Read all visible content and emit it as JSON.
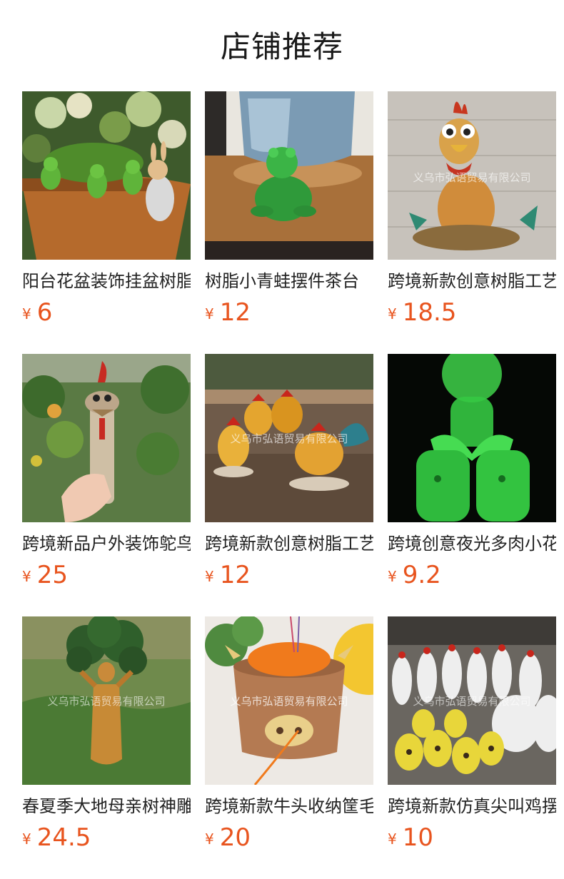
{
  "page": {
    "title": "店铺推荐"
  },
  "watermark": "义乌市弘语贸易有限公司",
  "products": [
    {
      "name": "阳台花盆装饰挂盆树脂",
      "currency": "¥",
      "price": "6",
      "image_icon": "frog-flowerpot-image"
    },
    {
      "name": "树脂小青蛙摆件茶台",
      "currency": "¥",
      "price": "12",
      "image_icon": "green-frog-image"
    },
    {
      "name": "跨境新款创意树脂工艺",
      "currency": "¥",
      "price": "18.5",
      "image_icon": "yoga-rooster-image"
    },
    {
      "name": "跨境新品户外装饰鸵鸟",
      "currency": "¥",
      "price": "25",
      "image_icon": "garden-stake-rooster-image"
    },
    {
      "name": "跨境新款创意树脂工艺",
      "currency": "¥",
      "price": "12",
      "image_icon": "rooster-figurines-image"
    },
    {
      "name": "跨境创意夜光多肉小花",
      "currency": "¥",
      "price": "9.2",
      "image_icon": "glowing-planter-image"
    },
    {
      "name": "春夏季大地母亲树神雕",
      "currency": "¥",
      "price": "24.5",
      "image_icon": "mother-earth-statue-image"
    },
    {
      "name": "跨境新款牛头收纳筐毛",
      "currency": "¥",
      "price": "20",
      "image_icon": "bull-yarn-bowl-image"
    },
    {
      "name": "跨境新款仿真尖叫鸡摆",
      "currency": "¥",
      "price": "10",
      "image_icon": "screaming-chickens-image"
    }
  ],
  "colors": {
    "price": "#e8541e",
    "text": "#222222",
    "background": "#ffffff"
  }
}
